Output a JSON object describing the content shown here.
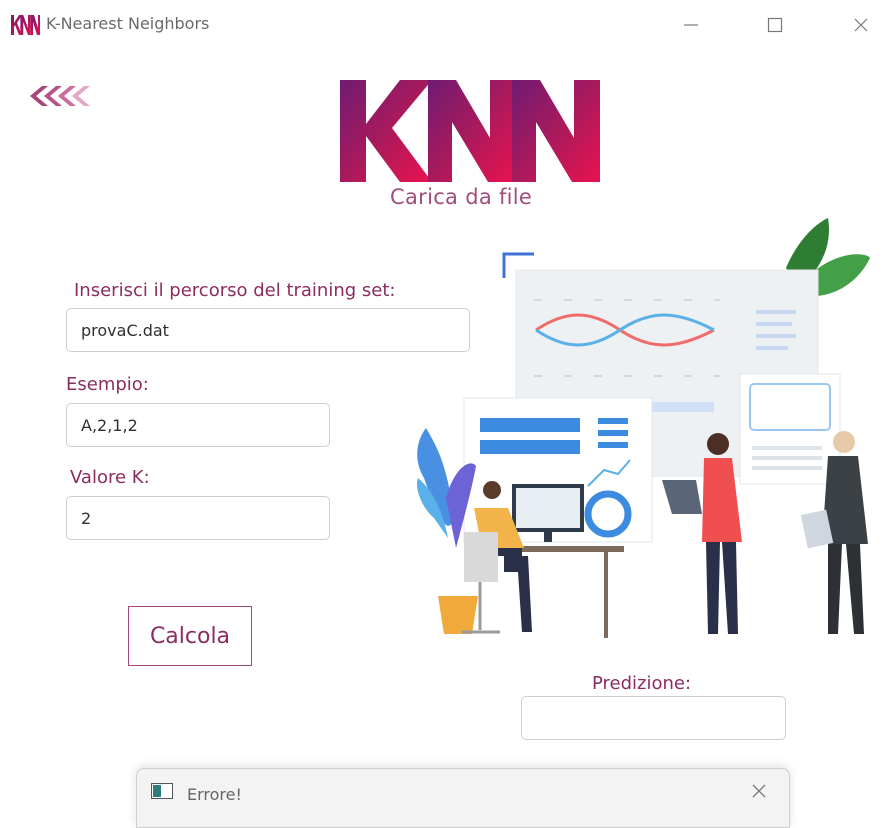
{
  "window": {
    "title": "K-Nearest Neighbors",
    "icon": "knn-app-icon",
    "controls": [
      "minimize-icon",
      "maximize-icon",
      "close-icon"
    ]
  },
  "header": {
    "back_icon": "back-chevrons-icon",
    "logo_text": "KNN",
    "subtitle": "Carica da file"
  },
  "form": {
    "path_label": "Inserisci il percorso del training set:",
    "path_value": "provaC.dat",
    "example_label": "Esempio:",
    "example_value": "A,2,1,2",
    "k_label": "Valore K:",
    "k_value": "2",
    "calculate_label": "Calcola",
    "prediction_label": "Predizione:",
    "prediction_value": ""
  },
  "error_dialog": {
    "title": "Errore!",
    "icon": "window-icon",
    "close_icon": "close-icon"
  },
  "colors": {
    "accent": "#8c2d60",
    "logo_gradient_start": "#7a1c6b",
    "logo_gradient_end": "#e0114f",
    "border": "#cfcfcf"
  }
}
